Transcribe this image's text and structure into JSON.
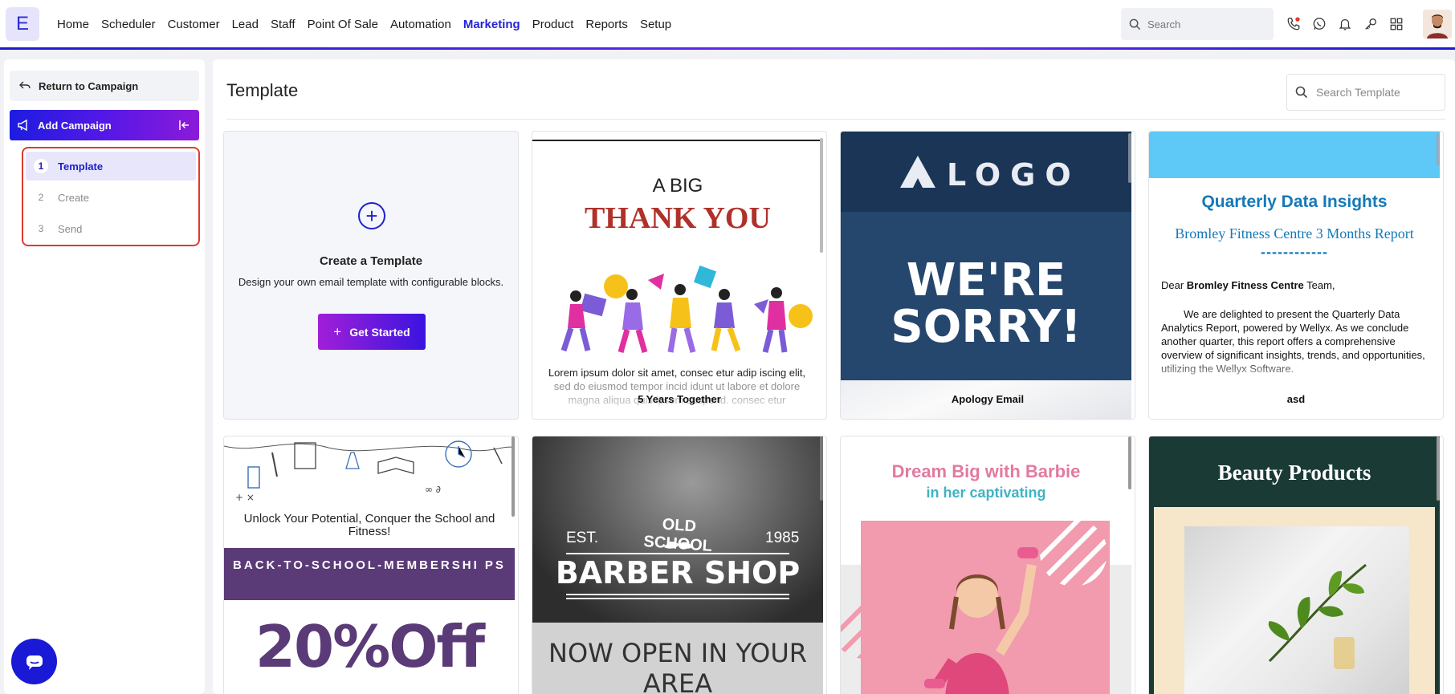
{
  "app": {
    "logo_letter": "E"
  },
  "nav": {
    "items": [
      "Home",
      "Scheduler",
      "Customer",
      "Lead",
      "Staff",
      "Point Of Sale",
      "Automation",
      "Marketing",
      "Product",
      "Reports",
      "Setup"
    ],
    "active": "Marketing"
  },
  "search": {
    "placeholder": "Search"
  },
  "sidebar": {
    "return_label": "Return to Campaign",
    "add_campaign_label": "Add Campaign",
    "steps": [
      {
        "num": "1",
        "label": "Template",
        "active": true
      },
      {
        "num": "2",
        "label": "Create",
        "active": false
      },
      {
        "num": "3",
        "label": "Send",
        "active": false
      }
    ]
  },
  "main": {
    "title": "Template",
    "search_placeholder": "Search Template",
    "create_card": {
      "title": "Create a Template",
      "description": "Design your own email template with configurable blocks.",
      "button": "Get Started"
    },
    "templates": [
      {
        "name": "5 Years Together",
        "heading_small": "A BIG",
        "heading_big": "THANK YOU",
        "body": "Lorem ipsum dolor sit amet, consec etur adip iscing elit, sed do eiusmod tempor incid idunt ut labore et dolore magna aliqua quis ipsum suspend. consec etur"
      },
      {
        "name": "Apology Email",
        "logo": "LOGO",
        "headline1": "WE'RE",
        "headline2": "SORRY!"
      },
      {
        "name": "asd",
        "title": "Quarterly Data Insights",
        "subtitle": "Bromley Fitness Centre 3 Months Report",
        "dashes": "------------",
        "greeting_pre": "Dear ",
        "greeting_bold": "Bromley Fitness Centre",
        "greeting_post": " Team,",
        "body": "We are delighted to present the Quarterly Data Analytics Report, powered by Wellyx. As we conclude another quarter, this report offers a comprehensive overview of significant insights, trends, and opportunities, utilizing the Wellyx Software."
      },
      {
        "tagline": "Unlock Your Potential, Conquer the School and Fitness!",
        "banner": "BACK-TO-SCHOOL-MEMBERSHI PS",
        "offer": "20%Off"
      },
      {
        "est": "EST.",
        "year": "1985",
        "brand_top": "OLD SCHOOL",
        "brand_main": "BARBER SHOP",
        "open_text": "NOW OPEN IN YOUR AREA"
      },
      {
        "title": "Dream Big with Barbie",
        "subtitle": "in her captivating"
      },
      {
        "title": "Beauty Products"
      }
    ]
  },
  "colors": {
    "accent": "#2424d8",
    "highlight_border": "#e03a2c",
    "thank_you_red": "#b0312a",
    "sorry_bg": "#25466d",
    "quarterly_blue": "#1479b8",
    "school_purple": "#5b3a78",
    "beauty_green": "#1a3a36"
  }
}
